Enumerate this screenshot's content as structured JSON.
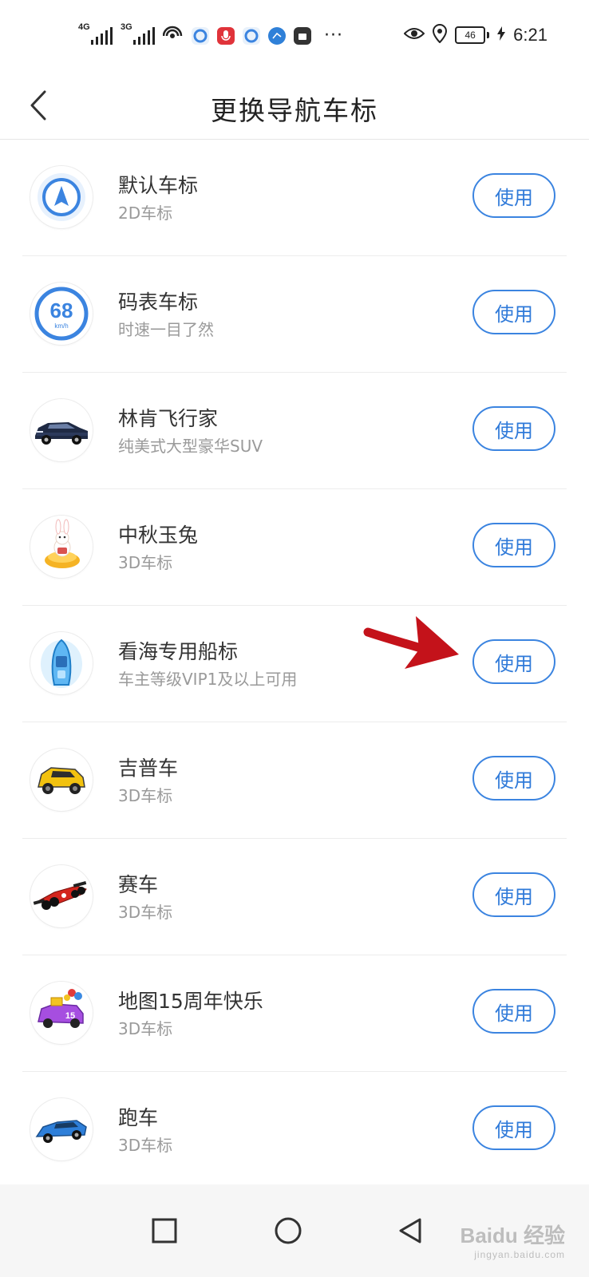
{
  "status_bar": {
    "net1": "4G",
    "net2": "3G",
    "battery": "46",
    "time": "6:21"
  },
  "header": {
    "title": "更换导航车标"
  },
  "use_label": "使用",
  "items": [
    {
      "name": "默认车标",
      "sub": "2D车标"
    },
    {
      "name": "码表车标",
      "sub": "时速一目了然",
      "speed": "68",
      "unit": "km/h"
    },
    {
      "name": "林肯飞行家",
      "sub": "纯美式大型豪华SUV"
    },
    {
      "name": "中秋玉兔",
      "sub": "3D车标"
    },
    {
      "name": "看海专用船标",
      "sub": "车主等级VIP1及以上可用"
    },
    {
      "name": "吉普车",
      "sub": "3D车标"
    },
    {
      "name": "赛车",
      "sub": "3D车标"
    },
    {
      "name": "地图15周年快乐",
      "sub": "3D车标",
      "badge": "15"
    },
    {
      "name": "跑车",
      "sub": "3D车标"
    }
  ],
  "colors": {
    "accent": "#3b84e0",
    "annotation_arrow": "#c4121a"
  },
  "watermark": {
    "brand": "Baidu 经验",
    "url": "jingyan.baidu.com"
  }
}
